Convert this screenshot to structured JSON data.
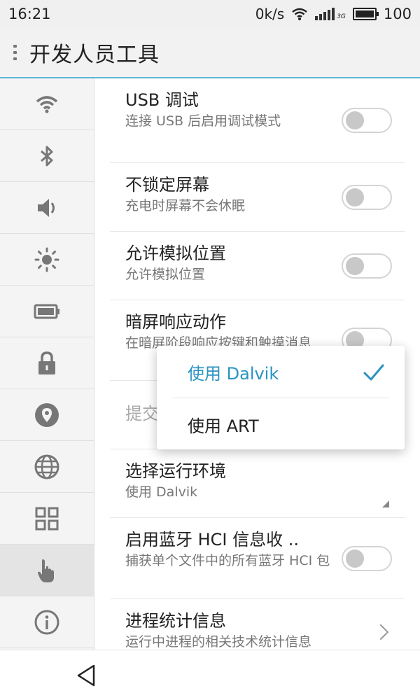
{
  "status": {
    "time": "16:21",
    "speed": "0k/s",
    "network": "3G",
    "battery": "100"
  },
  "header": {
    "title": "开发人员工具"
  },
  "sidebar": {
    "items": [
      {
        "icon": "wifi-icon"
      },
      {
        "icon": "bluetooth-icon"
      },
      {
        "icon": "volume-icon"
      },
      {
        "icon": "brightness-icon"
      },
      {
        "icon": "battery-icon"
      },
      {
        "icon": "lock-icon"
      },
      {
        "icon": "location-icon"
      },
      {
        "icon": "globe-icon"
      },
      {
        "icon": "apps-grid-icon"
      },
      {
        "icon": "hand-pointer-icon",
        "active": true
      },
      {
        "icon": "info-icon"
      }
    ]
  },
  "settings": {
    "usb_debug": {
      "title": "USB 调试",
      "subtitle": "连接 USB 后启用调试模式"
    },
    "stay_awake": {
      "title": "不锁定屏幕",
      "subtitle": "充电时屏幕不会休眠"
    },
    "mock_location": {
      "title": "允许模拟位置",
      "subtitle": "允许模拟位置"
    },
    "dim_screen": {
      "title": "暗屏响应动作",
      "subtitle": "在暗屏阶段响应按键和触摸消息"
    },
    "submit": {
      "title": "提交"
    },
    "runtime": {
      "title": "选择运行环境",
      "subtitle": "使用 Dalvik"
    },
    "bt_hci": {
      "title": "启用蓝牙 HCI 信息收 ..",
      "subtitle": "捕获单个文件中的所有蓝牙 HCI 包"
    },
    "proc_stats": {
      "title": "进程统计信息",
      "subtitle": "运行中进程的相关技术统计信息"
    }
  },
  "popup": {
    "options": [
      {
        "label": "使用 Dalvik",
        "selected": true
      },
      {
        "label": "使用 ART",
        "selected": false
      }
    ]
  },
  "colors": {
    "accent": "#2a93c2",
    "header_border": "#5bb5d6"
  }
}
